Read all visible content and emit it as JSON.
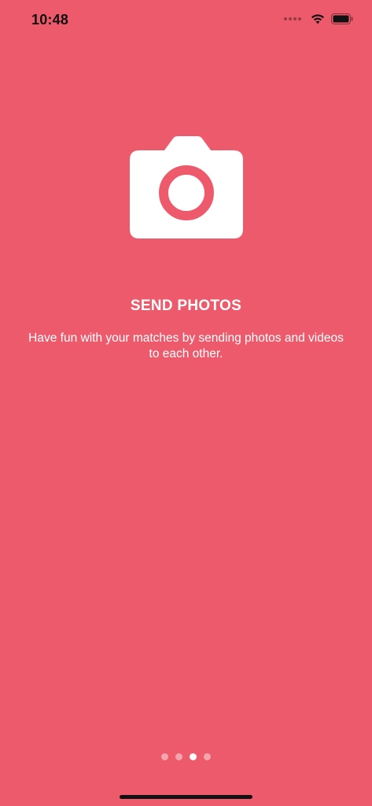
{
  "status_bar": {
    "time": "10:48"
  },
  "onboarding": {
    "icon": "camera-icon",
    "title": "SEND PHOTOS",
    "description": "Have fun with your matches by sending photos and videos to each other."
  },
  "pager": {
    "total_pages": 4,
    "active_index": 2
  },
  "colors": {
    "background": "#EC5A6B",
    "foreground": "#FFFFFF"
  }
}
